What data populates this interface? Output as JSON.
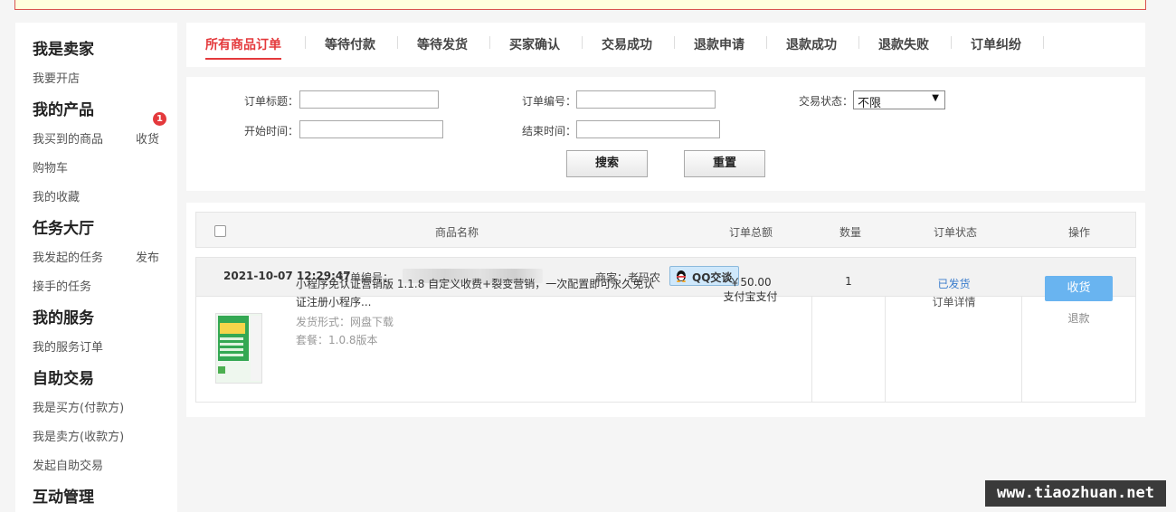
{
  "sidebar": {
    "seller_head": "我是卖家",
    "open_shop": "我要开店",
    "products_head": "我的产品",
    "bought": "我买到的商品",
    "receive": "收货",
    "receive_count": "1",
    "cart": "购物车",
    "favorites": "我的收藏",
    "tasks_head": "任务大厅",
    "my_tasks": "我发起的任务",
    "publish": "发布",
    "accepted_tasks": "接手的任务",
    "services_head": "我的服务",
    "service_orders": "我的服务订单",
    "self_trade_head": "自助交易",
    "buyer_side": "我是买方(付款方)",
    "seller_side": "我是卖方(收款方)",
    "start_trade": "发起自助交易",
    "interaction_head": "互动管理"
  },
  "tabs": [
    "所有商品订单",
    "等待付款",
    "等待发货",
    "买家确认",
    "交易成功",
    "退款申请",
    "退款成功",
    "退款失败",
    "订单纠纷"
  ],
  "filter": {
    "title_label": "订单标题：",
    "order_no_label": "订单编号：",
    "status_label": "交易状态：",
    "status_value": "不限",
    "start_label": "开始时间：",
    "end_label": "结束时间：",
    "search_btn": "搜索",
    "reset_btn": "重置"
  },
  "table": {
    "col_name": "商品名称",
    "col_total": "订单总额",
    "col_qty": "数量",
    "col_status": "订单状态",
    "col_action": "操作"
  },
  "order": {
    "date": "2021-10-07 12:29:47",
    "order_no_label": "订单编号：",
    "merchant_label": "商家：",
    "merchant": "老码农",
    "qq_label": "QQ交谈",
    "product_title": "小程序免认证营销版 1.1.8 自定义收费+裂变营销，一次配置即可永久免认证注册小程序...",
    "delivery": "发货形式：网盘下载",
    "package": "套餐：1.0.8版本",
    "price": "￥50.00",
    "payment": "支付宝支付",
    "quantity": "1",
    "status": "已发货",
    "detail_link": "订单详情",
    "receive_btn": "收货",
    "refund_link": "退款"
  },
  "watermark": "www.tiaozhuan.net"
}
